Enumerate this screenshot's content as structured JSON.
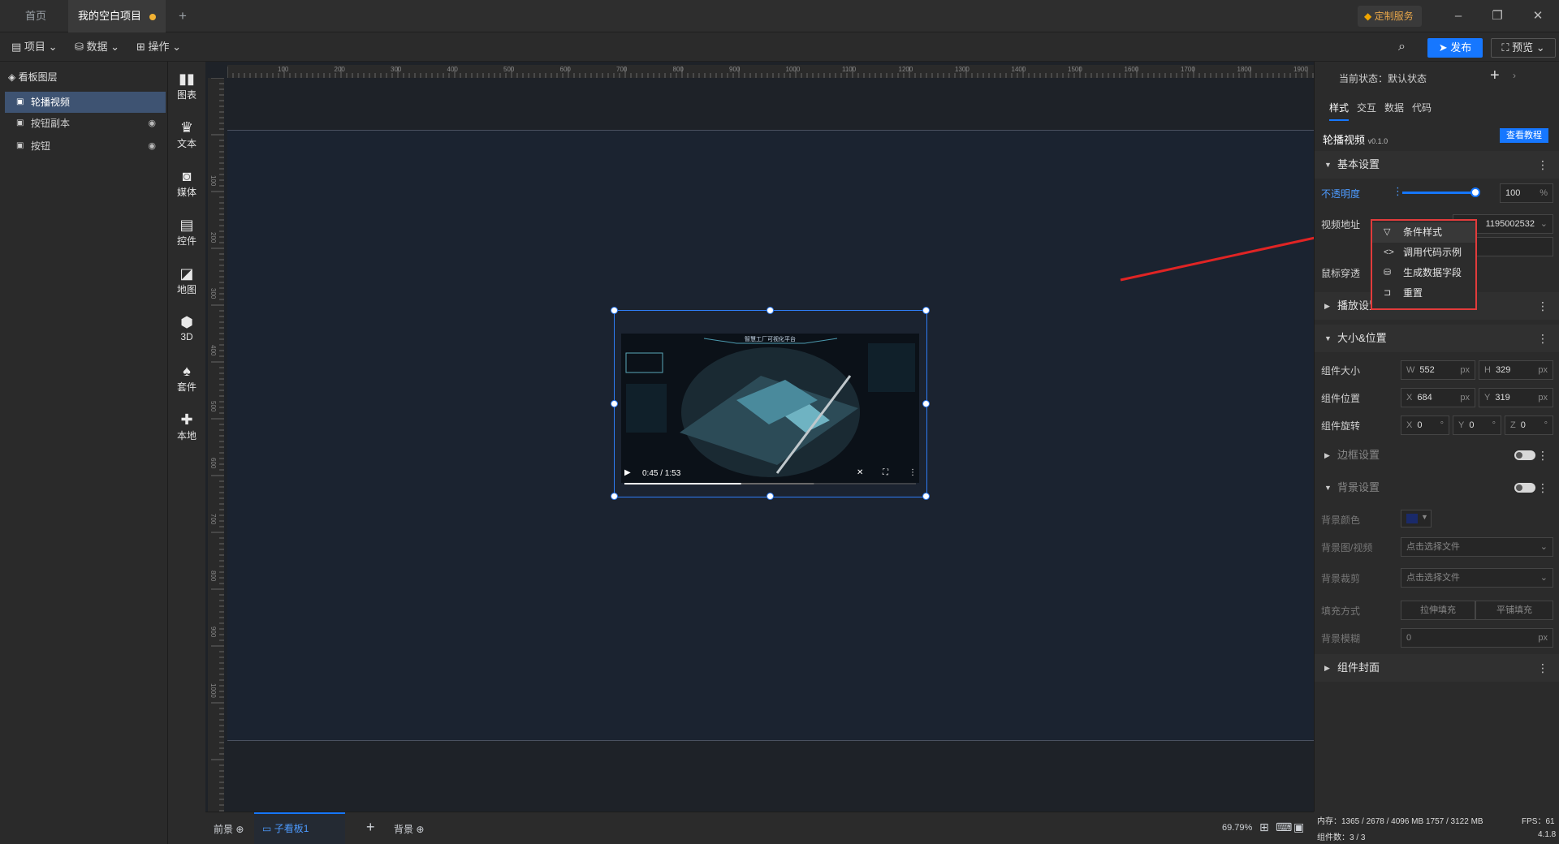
{
  "titlebar": {
    "tabs": [
      {
        "label": "首页"
      },
      {
        "label": "我的空白项目"
      }
    ],
    "new_tab": "+",
    "custom_service": "定制服务",
    "window_controls": {
      "min": "–",
      "max": "❐",
      "close": "✕"
    }
  },
  "toolbar": {
    "project": "项目",
    "data": "数据",
    "operation": "操作",
    "publish": "发布",
    "preview": "预览"
  },
  "layers": {
    "title": "看板图层",
    "items": [
      {
        "label": "轮播视频"
      },
      {
        "label": "按钮副本"
      },
      {
        "label": "按钮"
      }
    ]
  },
  "rail": [
    {
      "label": "图表"
    },
    {
      "label": "文本"
    },
    {
      "label": "媒体"
    },
    {
      "label": "控件"
    },
    {
      "label": "地图"
    },
    {
      "label": "3D"
    },
    {
      "label": "套件"
    },
    {
      "label": "本地"
    }
  ],
  "ruler": {
    "top": [
      "100",
      "200",
      "300",
      "400",
      "500",
      "600",
      "700",
      "800",
      "900",
      "1000",
      "1100",
      "1200",
      "1300",
      "1400",
      "1500",
      "1600",
      "1700",
      "1800",
      "1900"
    ],
    "left": [
      "100",
      "200",
      "300",
      "400",
      "500",
      "600",
      "700",
      "800",
      "900",
      "1000"
    ]
  },
  "video": {
    "header_title": "智慧工厂可视化平台",
    "time": "0:45 / 1:53",
    "progress": 0.4,
    "buffered": 0.65
  },
  "bottom": {
    "front": "前景",
    "sub_board": "子看板1",
    "add": "+",
    "back": "背景",
    "zoom": "69.79%"
  },
  "right": {
    "state_label": "当前状态：",
    "state_value": "默认状态",
    "tabs": [
      "样式",
      "交互",
      "数据",
      "代码"
    ],
    "component_name": "轮播视频",
    "version": "v0.1.0",
    "tutorial": "查看教程",
    "basic": "基本设置",
    "opacity_label": "不透明度",
    "opacity_value": "100",
    "opacity_unit": "%",
    "video_url_label": "视频地址",
    "video_url_value": "1195002532",
    "mouse_label": "鼠标穿透",
    "play": "播放设置",
    "size_pos": "大小&位置",
    "size_label": "组件大小",
    "w": "552",
    "h": "329",
    "pos_label": "组件位置",
    "x": "684",
    "y": "319",
    "rot_label": "组件旋转",
    "rx": "0",
    "ry": "0",
    "rz": "0",
    "px": "px",
    "deg": "°",
    "border": "边框设置",
    "bg": "背景设置",
    "bg_color": "背景颜色",
    "bg_media": "背景图/视频",
    "bg_crop": "背景裁剪",
    "choose_file": "点击选择文件",
    "fill": "填充方式",
    "stretch": "拉伸填充",
    "tile": "平铺填充",
    "blur": "背景模糊",
    "blur_value": "0",
    "cover": "组件封面"
  },
  "context_menu": [
    {
      "label": "条件样式"
    },
    {
      "label": "调用代码示例"
    },
    {
      "label": "生成数据字段"
    },
    {
      "label": "重置"
    }
  ],
  "status": {
    "memory": "内存：1365 / 2678 / 4096 MB  1757 / 3122 MB",
    "fps": "FPS：61",
    "count": "组件数：3 / 3",
    "version": "4.1.8"
  },
  "colors": {
    "accent": "#1677ff",
    "highlight_box": "#e23b3b",
    "arrow": "#e02424"
  }
}
